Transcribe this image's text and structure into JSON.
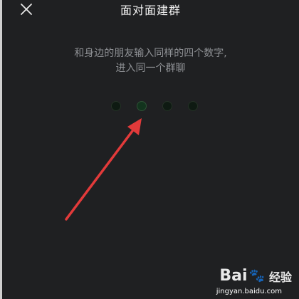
{
  "header": {
    "title": "面对面建群",
    "close_icon": "close-icon"
  },
  "hint": {
    "line1": "和身边的朋友输入同样的四个数字,",
    "line2": "进入同一个群聊"
  },
  "code_input": {
    "digit_count": 4,
    "entered_digits": 0
  },
  "watermark": {
    "brand": "Bai",
    "paw": "🐾",
    "brand_suffix": "经验",
    "url": "jingyan.baidu.com"
  },
  "colors": {
    "background": "#1f2022",
    "arrow": "#e23a3a",
    "text": "#f0f0f0",
    "hint_text": "#8e9094"
  }
}
